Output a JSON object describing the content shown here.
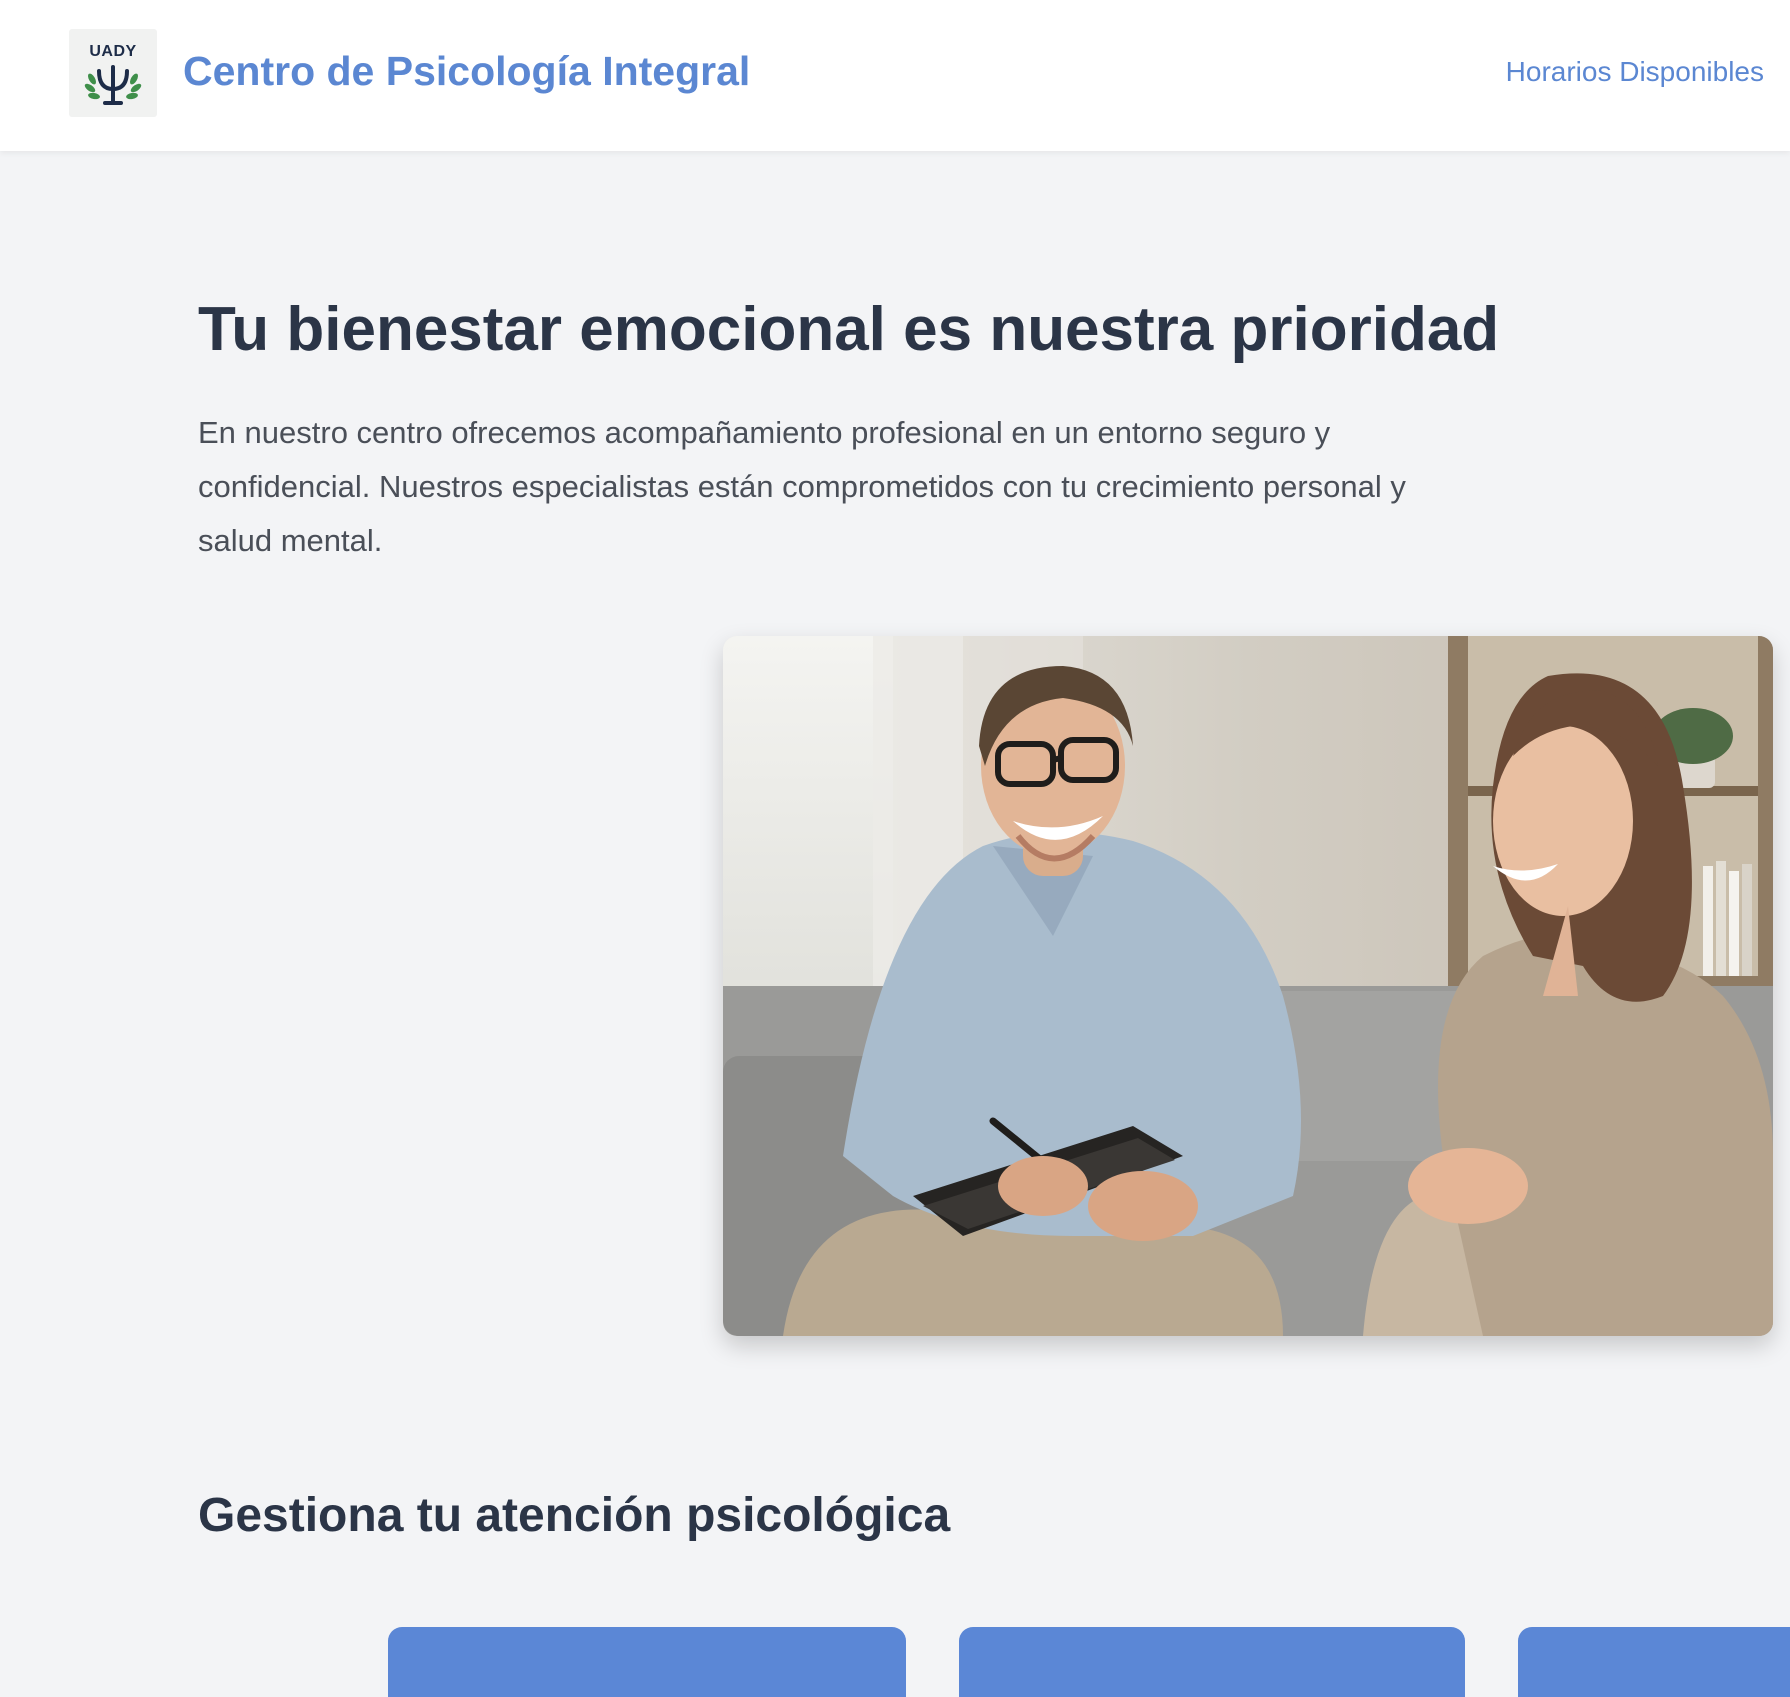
{
  "header": {
    "logo_text": "UADY",
    "brand_title": "Centro de Psicología Integral",
    "nav_link": "Horarios Disponibles"
  },
  "hero": {
    "title": "Tu bienestar emocional es nuestra prioridad",
    "description": "En nuestro centro ofrecemos acompañamiento profesional en un entorno seguro y confidencial. Nuestros especialistas están comprometidos con tu crecimiento personal y salud mental."
  },
  "section": {
    "title": "Gestiona tu atención psicológica"
  },
  "colors": {
    "brand_blue": "#5b87d2",
    "heading": "#2b3547",
    "card_blue": "#5b87d6",
    "background": "#f3f4f6"
  },
  "icons": {
    "logo": "psi-laurel-logo"
  }
}
